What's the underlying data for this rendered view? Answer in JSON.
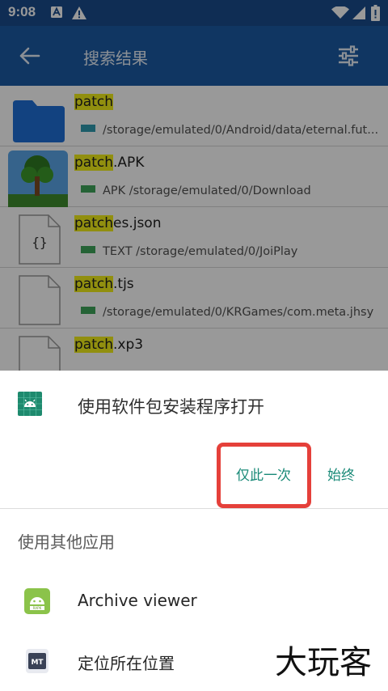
{
  "status_bar": {
    "time": "9:08",
    "icons": [
      "notification-a-icon",
      "warning-icon",
      "wifi-icon",
      "signal-icon",
      "battery-icon"
    ]
  },
  "app_bar": {
    "title": "搜索结果",
    "back_icon": "back-arrow-icon",
    "filter_icon": "filter-sliders-icon",
    "background_color": "#1c5ba4"
  },
  "results": [
    {
      "match": "patch",
      "suffix": "",
      "path": "/storage/emulated/0/Android/data/eternal.fut...",
      "tag_color": "#2f9bb0",
      "icon": "folder-icon"
    },
    {
      "match": "patch",
      "suffix": ".APK",
      "path": "APK /storage/emulated/0/Download",
      "tag_color": "#3fa55a",
      "icon": "apk-thumbnail-icon"
    },
    {
      "match": "patch",
      "suffix": "es.json",
      "path": "TEXT /storage/emulated/0/JoiPlay",
      "tag_color": "#3fa55a",
      "icon": "json-file-icon"
    },
    {
      "match": "patch",
      "suffix": ".tjs",
      "path": "/storage/emulated/0/KRGames/com.meta.jhsy",
      "tag_color": "#3fa55a",
      "icon": "file-icon"
    },
    {
      "match": "patch",
      "suffix": ".xp3",
      "path": "",
      "tag_color": "#3fa55a",
      "icon": "file-icon"
    }
  ],
  "sheet": {
    "title": "使用软件包安装程序打开",
    "app_icon": "android-package-installer-icon",
    "once_label": "仅此一次",
    "always_label": "始终",
    "accent_color": "#1a8a78",
    "highlight_color": "#e5403a",
    "other_apps_label": "使用其他应用",
    "other_apps": [
      {
        "label": "Archive viewer",
        "icon": "archive-viewer-icon"
      },
      {
        "label": "定位所在位置",
        "icon": "mt-manager-icon"
      }
    ]
  },
  "watermark": {
    "text": "大玩客"
  }
}
